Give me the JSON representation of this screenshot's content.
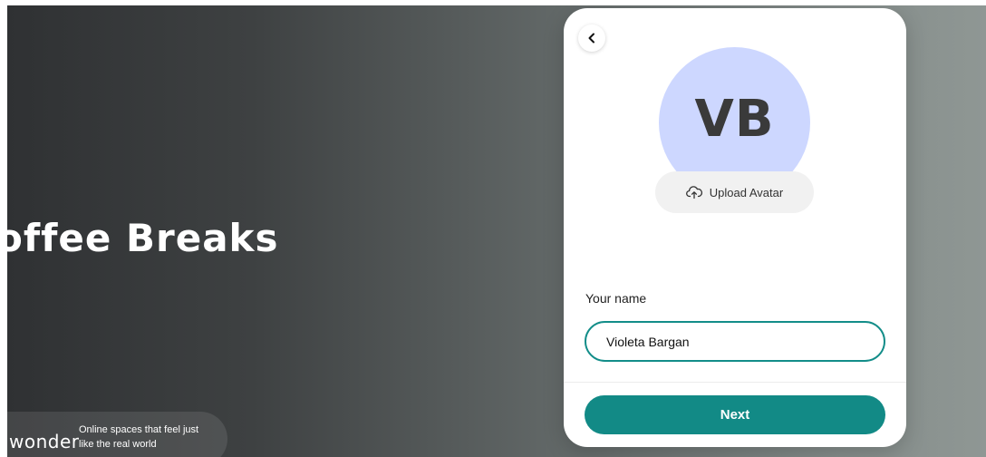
{
  "hero": {
    "title": "offee Breaks"
  },
  "brand": {
    "logo_text": "wonder",
    "tagline": "Online spaces that feel just like the real world"
  },
  "card": {
    "back_icon": "chevron-left-icon",
    "avatar": {
      "initials": "VB",
      "color": "#cdd7ff"
    },
    "upload": {
      "icon": "cloud-upload-icon",
      "label": "Upload Avatar"
    },
    "name_field": {
      "label": "Your name",
      "value": "Violeta Bargan",
      "placeholder": ""
    },
    "next_button": {
      "label": "Next",
      "color": "#128a86"
    }
  }
}
